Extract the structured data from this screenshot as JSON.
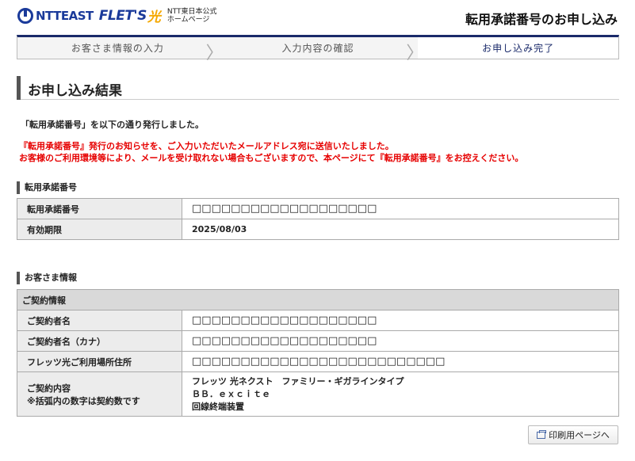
{
  "header": {
    "logo_ntt": "NTTEAST",
    "logo_flets": "FLET'S",
    "logo_hikari": "光",
    "logo_sub_line1": "NTT東日本公式",
    "logo_sub_line2": "ホームページ",
    "page_title": "転用承諾番号のお申し込み"
  },
  "steps": [
    {
      "label": "お客さま情報の入力",
      "active": false
    },
    {
      "label": "入力内容の確認",
      "active": false
    },
    {
      "label": "お申し込み完了",
      "active": true
    }
  ],
  "section_title": "お申し込み結果",
  "messages": {
    "issued": "「転用承諾番号」を以下の通り発行しました。",
    "red_line1": "『転用承諾番号』発行のお知らせを、ご入力いただいたメールアドレス宛に送信いたしました。",
    "red_line2": "お客様のご利用環境等により、メールを受け取れない場合もございますので、本ページにて『転用承諾番号』をお控えください。"
  },
  "approval": {
    "title": "転用承諾番号",
    "rows": [
      {
        "label": "転用承諾番号",
        "value": "□□□□□□□□□□□□□□□□□□□"
      },
      {
        "label": "有効期限",
        "value": "2025/08/03"
      }
    ]
  },
  "customer": {
    "title": "お客さま情報",
    "contract_header": "ご契約情報",
    "rows": [
      {
        "label": "ご契約者名",
        "value": "□□□□□□□□□□□□□□□□□□□"
      },
      {
        "label": "ご契約者名（カナ）",
        "value": "□□□□□□□□□□□□□□□□□□□"
      },
      {
        "label": "フレッツ光ご利用場所住所",
        "value": "□□□□□□□□□□□□□□□□□□□□□□□□□□"
      }
    ],
    "contract_label1": "ご契約内容",
    "contract_label2": "※括弧内の数字は契約数です",
    "contract_value1": "フレッツ 光ネクスト　ファミリー・ギガラインタイプ",
    "contract_value2": "ＢＢ．ｅｘｃｉｔｅ",
    "contract_value3": "回線終端装置"
  },
  "print_button": "印刷用ページへ"
}
